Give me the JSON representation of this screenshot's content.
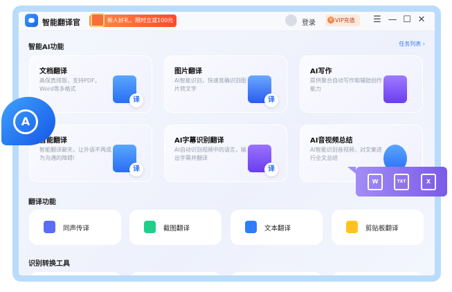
{
  "titlebar": {
    "app_name": "智能翻译官",
    "promo": "新人好礼，限时立减100元",
    "login": "登录",
    "vip": "VIP充值",
    "menu": "☰",
    "minimize": "—",
    "maximize": "☐",
    "close": "✕"
  },
  "ai_section": {
    "title": "智能AI功能",
    "task_list": "任务列表 ›",
    "cards": [
      {
        "title": "文档翻译",
        "desc": "高保真排版，支持PDF，Word等多格式",
        "icon": "word-doc-icon"
      },
      {
        "title": "图片翻译",
        "desc": "AI智能识别，快速准确识别图片转文字",
        "icon": "image-icon"
      },
      {
        "title": "AI写作",
        "desc": "提供聚合自动写作和辅助创作能力",
        "icon": "writing-icon"
      },
      {
        "title": "智能翻译",
        "desc": "智能翻译聊天，让外语不再成为沟通的障碍!",
        "icon": "chat-icon"
      },
      {
        "title": "AI字幕识别翻译",
        "desc": "AI自动识别视频中的语言，输出字幕并翻译",
        "icon": "video-icon"
      },
      {
        "title": "AI音视频总结",
        "desc": "AI智能识别音视频，对文案进行全文总结",
        "icon": "audio-icon"
      }
    ],
    "badge": "译"
  },
  "translate_section": {
    "title": "翻译功能",
    "items": [
      {
        "label": "同声传译",
        "color": "#5b6cf5"
      },
      {
        "label": "截图翻译",
        "color": "#1fcf8a"
      },
      {
        "label": "文本翻译",
        "color": "#2f7df6"
      },
      {
        "label": "剪贴板翻译",
        "color": "#ffc21f"
      }
    ]
  },
  "tools_section": {
    "title": "识别转换工具"
  },
  "popup": {
    "formats": [
      "W",
      "TXT",
      "X"
    ]
  }
}
